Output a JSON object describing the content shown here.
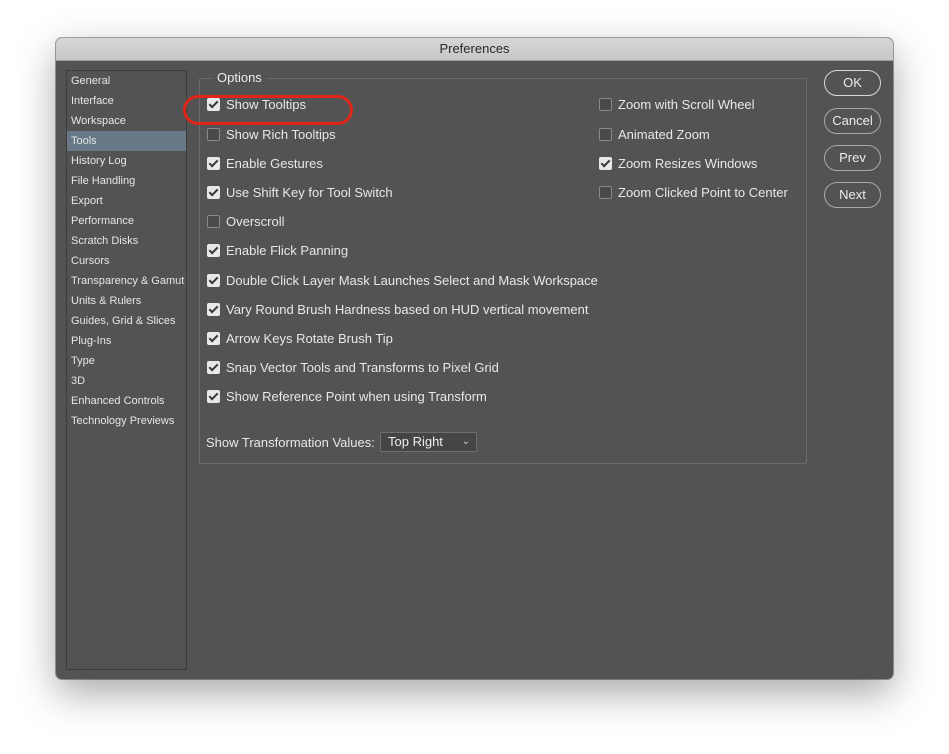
{
  "window": {
    "title": "Preferences"
  },
  "sidebar": {
    "items": [
      {
        "label": "General",
        "selected": false
      },
      {
        "label": "Interface",
        "selected": false
      },
      {
        "label": "Workspace",
        "selected": false
      },
      {
        "label": "Tools",
        "selected": true
      },
      {
        "label": "History Log",
        "selected": false
      },
      {
        "label": "File Handling",
        "selected": false
      },
      {
        "label": "Export",
        "selected": false
      },
      {
        "label": "Performance",
        "selected": false
      },
      {
        "label": "Scratch Disks",
        "selected": false
      },
      {
        "label": "Cursors",
        "selected": false
      },
      {
        "label": "Transparency & Gamut",
        "selected": false
      },
      {
        "label": "Units & Rulers",
        "selected": false
      },
      {
        "label": "Guides, Grid & Slices",
        "selected": false
      },
      {
        "label": "Plug-Ins",
        "selected": false
      },
      {
        "label": "Type",
        "selected": false
      },
      {
        "label": "3D",
        "selected": false
      },
      {
        "label": "Enhanced Controls",
        "selected": false
      },
      {
        "label": "Technology Previews",
        "selected": false
      }
    ]
  },
  "options": {
    "group_label": "Options",
    "left": [
      {
        "label": "Show Tooltips",
        "checked": true
      },
      {
        "label": "Show Rich Tooltips",
        "checked": false
      },
      {
        "label": "Enable Gestures",
        "checked": true
      },
      {
        "label": "Use Shift Key for Tool Switch",
        "checked": true
      },
      {
        "label": "Overscroll",
        "checked": false
      },
      {
        "label": "Enable Flick Panning",
        "checked": true
      },
      {
        "label": "Double Click Layer Mask Launches Select and Mask Workspace",
        "checked": true
      },
      {
        "label": "Vary Round Brush Hardness based on HUD vertical movement",
        "checked": true
      },
      {
        "label": "Arrow Keys Rotate Brush Tip",
        "checked": true
      },
      {
        "label": "Snap Vector Tools and Transforms to Pixel Grid",
        "checked": true
      },
      {
        "label": "Show Reference Point when using Transform",
        "checked": true
      }
    ],
    "right": [
      {
        "label": "Zoom with Scroll Wheel",
        "checked": false
      },
      {
        "label": "Animated Zoom",
        "checked": false
      },
      {
        "label": "Zoom Resizes Windows",
        "checked": true
      },
      {
        "label": "Zoom Clicked Point to Center",
        "checked": false
      }
    ],
    "transformation_label": "Show Transformation Values:",
    "transformation_value": "Top Right"
  },
  "buttons": {
    "ok": "OK",
    "cancel": "Cancel",
    "prev": "Prev",
    "next": "Next"
  },
  "colors": {
    "highlight_ring": "#e0261b",
    "selected_item": "#687886"
  },
  "icons": {
    "dropdown": "chevron-down-icon",
    "checkbox_checked": "checkmark-icon"
  }
}
